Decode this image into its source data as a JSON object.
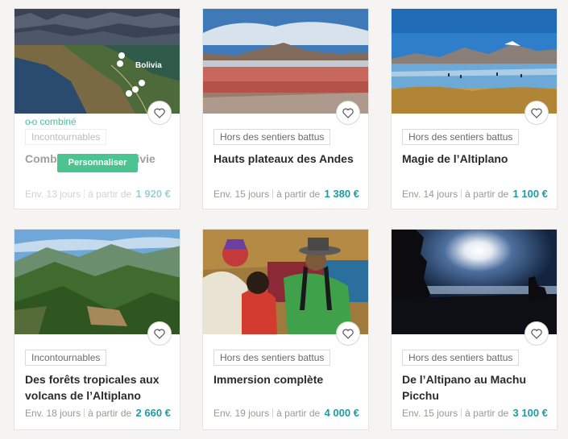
{
  "cards": [
    {
      "tag": "Incontournables",
      "title": "Combiné Pérou - Bolivie",
      "duration": "Env. 13 jours",
      "from_label": "à partir de",
      "price": "1 920 €",
      "combined_label": "combiné",
      "personalise_label": "Personnaliser",
      "map_label": "Bolivia",
      "image_icon": "map-image"
    },
    {
      "tag": "Hors des sentiers battus",
      "title": "Hauts plateaux des Andes",
      "duration": "Env. 15 jours",
      "from_label": "à partir de",
      "price": "1 380 €",
      "image_icon": "red-lagoon-image"
    },
    {
      "tag": "Hors des sentiers battus",
      "title": "Magie de l’Altiplano",
      "duration": "Env. 14 jours",
      "from_label": "à partir de",
      "price": "1 100 €",
      "image_icon": "flamingo-lagoon-image"
    },
    {
      "tag": "Incontournables",
      "title": "Des forêts tropicales aux volcans de l’Altiplano",
      "duration": "Env. 18 jours",
      "from_label": "à partir de",
      "price": "2 660 €",
      "image_icon": "green-valley-image"
    },
    {
      "tag": "Hors des sentiers battus",
      "title": "Immersion complète",
      "duration": "Env. 19 jours",
      "from_label": "à partir de",
      "price": "4 000 €",
      "image_icon": "andean-people-image"
    },
    {
      "tag": "Hors des sentiers battus",
      "title": "De l’Altipano au Machu Picchu",
      "duration": "Env. 15 jours",
      "from_label": "à partir de",
      "price": "3 100 €",
      "image_icon": "sunset-silhouette-image"
    }
  ],
  "colors": {
    "price": "#1e9aa6",
    "accent_green": "#4cc491",
    "background": "#f5f4f2"
  },
  "icons": {
    "favorite": "heart-icon",
    "combined": "link-dots-icon"
  }
}
